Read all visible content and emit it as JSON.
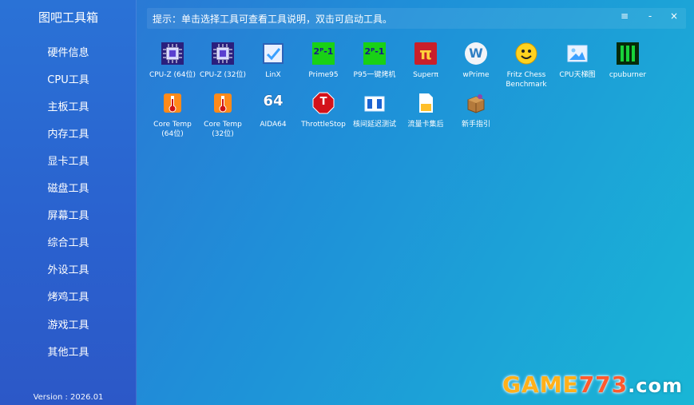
{
  "app": {
    "title": "图吧工具箱",
    "version": "Version : 2026.01"
  },
  "topbar": {
    "hint": "提示：单击选择工具可查看工具说明，双击可启动工具。",
    "menu_glyph": "≡",
    "min_glyph": "-",
    "close_glyph": "×"
  },
  "sidebar": {
    "items": [
      {
        "label": "硬件信息"
      },
      {
        "label": "CPU工具"
      },
      {
        "label": "主板工具"
      },
      {
        "label": "内存工具"
      },
      {
        "label": "显卡工具"
      },
      {
        "label": "磁盘工具"
      },
      {
        "label": "屏幕工具"
      },
      {
        "label": "综合工具"
      },
      {
        "label": "外设工具"
      },
      {
        "label": "烤鸡工具"
      },
      {
        "label": "游戏工具"
      },
      {
        "label": "其他工具"
      }
    ]
  },
  "tools": [
    {
      "label": "CPU-Z (64位)",
      "icon": "cpu-chip-icon"
    },
    {
      "label": "CPU-Z (32位)",
      "icon": "cpu-chip-icon"
    },
    {
      "label": "LinX",
      "icon": "checkbox-icon"
    },
    {
      "label": "Prime95",
      "icon": "prime-formula-icon",
      "glyph": "2ᴾ-1"
    },
    {
      "label": "P95一键烤机",
      "icon": "prime-formula-icon",
      "glyph": "2ᴾ-1"
    },
    {
      "label": "Superπ",
      "icon": "super-pi-icon",
      "glyph": "π"
    },
    {
      "label": "wPrime",
      "icon": "wprime-icon",
      "glyph": "W"
    },
    {
      "label": "Fritz Chess\nBenchmark",
      "icon": "smiley-face-icon"
    },
    {
      "label": "CPU天梯图",
      "icon": "picture-icon"
    },
    {
      "label": "cpuburner",
      "icon": "green-bars-icon"
    },
    {
      "label": "Core Temp\n(64位)",
      "icon": "thermometer-icon"
    },
    {
      "label": "Core Temp\n(32位)",
      "icon": "thermometer-icon"
    },
    {
      "label": "AIDA64",
      "icon": "aida64-icon",
      "glyph": "64"
    },
    {
      "label": "ThrottleStop",
      "icon": "stop-sign-icon",
      "glyph": "T"
    },
    {
      "label": "核间延迟测试",
      "icon": "window-panels-icon"
    },
    {
      "label": "流量卡集后",
      "icon": "document-icon"
    },
    {
      "label": "新手指引",
      "icon": "package-icon"
    }
  ],
  "watermark": {
    "part1": "GAME",
    "part2": "773",
    "part3": ".com"
  },
  "colors": {
    "sidebar_top": "#2a72d6",
    "content_start": "#2f6fd3",
    "content_end": "#19b6d6",
    "text": "#ffffff"
  }
}
